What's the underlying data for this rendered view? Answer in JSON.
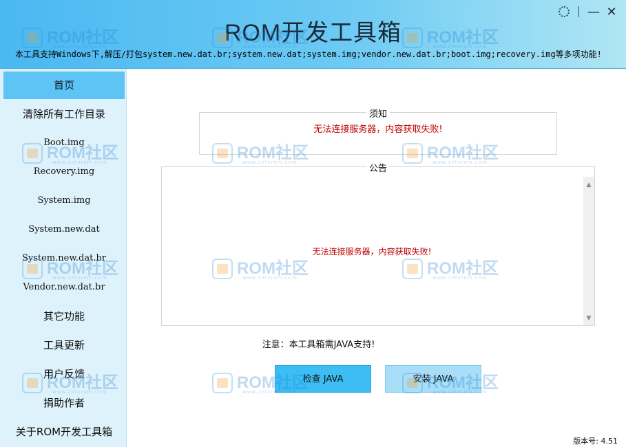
{
  "header": {
    "title": "ROM开发工具箱",
    "subtitle": "本工具支持Windows下,解压/打包system.new.dat.br;system.new.dat;system.img;vendor.new.dat.br;boot.img;recovery.img等多项功能!"
  },
  "window_controls": {
    "minimize_label": "—",
    "close_label": "✕"
  },
  "sidebar": {
    "items": [
      {
        "label": "首页"
      },
      {
        "label": "清除所有工作目录"
      },
      {
        "label": "Boot.img"
      },
      {
        "label": "Recovery.img"
      },
      {
        "label": "System.img"
      },
      {
        "label": "System.new.dat"
      },
      {
        "label": "System.new.dat.br"
      },
      {
        "label": "Vendor.new.dat.br"
      },
      {
        "label": "其它功能"
      },
      {
        "label": "工具更新"
      },
      {
        "label": "用户反馈"
      },
      {
        "label": "捐助作者"
      },
      {
        "label": "关于ROM开发工具箱"
      }
    ]
  },
  "notice": {
    "title": "须知",
    "text": "无法连接服务器，内容获取失败!"
  },
  "announcement": {
    "title": "公告",
    "text": "无法连接服务器，内容获取失败!"
  },
  "java_note": "注意：本工具箱需JAVA支持!",
  "buttons": {
    "check_java": "检查 JAVA",
    "install_java": "安装 JAVA"
  },
  "version": "版本号:  4.51",
  "watermark": {
    "brand": "ROM社区",
    "site": "www.zntvrom.com"
  },
  "colors": {
    "accent": "#5ec3f5",
    "error": "#c00000",
    "sidebar_bg": "#def2fb"
  }
}
